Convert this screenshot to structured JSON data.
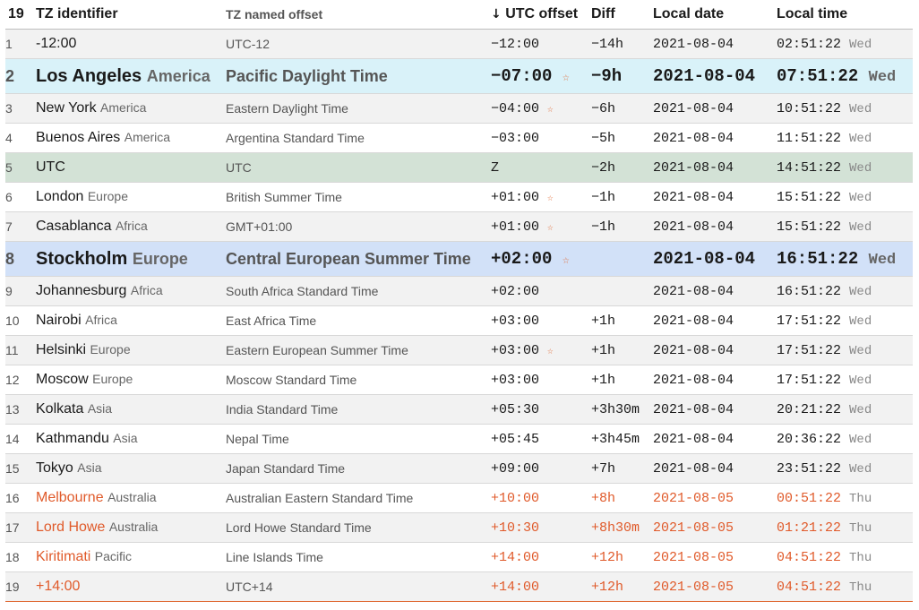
{
  "header": {
    "count": "19",
    "tz_identifier": "TZ identifier",
    "tz_named_offset": "TZ named offset",
    "sort_arrow": "↓",
    "utc_offset": "UTC offset",
    "diff": "Diff",
    "local_date": "Local date",
    "local_time": "Local time"
  },
  "rows": [
    {
      "idx": "1",
      "city": "-12:00",
      "region": "",
      "offset_name": "UTC-12",
      "utc": "−12:00",
      "star": "",
      "diff": "−14h",
      "date": "2021-08-04",
      "time": "02:51:22",
      "day": "Wed"
    },
    {
      "idx": "2",
      "city": "Los Angeles",
      "region": "America",
      "offset_name": "Pacific Daylight Time",
      "utc": "−07:00",
      "star": "☆",
      "diff": "−9h",
      "date": "2021-08-04",
      "time": "07:51:22",
      "day": "Wed"
    },
    {
      "idx": "3",
      "city": "New York",
      "region": "America",
      "offset_name": "Eastern Daylight Time",
      "utc": "−04:00",
      "star": "☆",
      "diff": "−6h",
      "date": "2021-08-04",
      "time": "10:51:22",
      "day": "Wed"
    },
    {
      "idx": "4",
      "city": "Buenos Aires",
      "region": "America",
      "offset_name": "Argentina Standard Time",
      "utc": "−03:00",
      "star": "",
      "diff": "−5h",
      "date": "2021-08-04",
      "time": "11:51:22",
      "day": "Wed"
    },
    {
      "idx": "5",
      "city": "UTC",
      "region": "",
      "offset_name": "UTC",
      "utc": "Z",
      "star": "",
      "diff": "−2h",
      "date": "2021-08-04",
      "time": "14:51:22",
      "day": "Wed"
    },
    {
      "idx": "6",
      "city": "London",
      "region": "Europe",
      "offset_name": "British Summer Time",
      "utc": "+01:00",
      "star": "☆",
      "diff": "−1h",
      "date": "2021-08-04",
      "time": "15:51:22",
      "day": "Wed"
    },
    {
      "idx": "7",
      "city": "Casablanca",
      "region": "Africa",
      "offset_name": "GMT+01:00",
      "utc": "+01:00",
      "star": "☆",
      "diff": "−1h",
      "date": "2021-08-04",
      "time": "15:51:22",
      "day": "Wed"
    },
    {
      "idx": "8",
      "city": "Stockholm",
      "region": "Europe",
      "offset_name": "Central European Summer Time",
      "utc": "+02:00",
      "star": "☆",
      "diff": "",
      "date": "2021-08-04",
      "time": "16:51:22",
      "day": "Wed"
    },
    {
      "idx": "9",
      "city": "Johannesburg",
      "region": "Africa",
      "offset_name": "South Africa Standard Time",
      "utc": "+02:00",
      "star": "",
      "diff": "",
      "date": "2021-08-04",
      "time": "16:51:22",
      "day": "Wed"
    },
    {
      "idx": "10",
      "city": "Nairobi",
      "region": "Africa",
      "offset_name": "East Africa Time",
      "utc": "+03:00",
      "star": "",
      "diff": "+1h",
      "date": "2021-08-04",
      "time": "17:51:22",
      "day": "Wed"
    },
    {
      "idx": "11",
      "city": "Helsinki",
      "region": "Europe",
      "offset_name": "Eastern European Summer Time",
      "utc": "+03:00",
      "star": "☆",
      "diff": "+1h",
      "date": "2021-08-04",
      "time": "17:51:22",
      "day": "Wed"
    },
    {
      "idx": "12",
      "city": "Moscow",
      "region": "Europe",
      "offset_name": "Moscow Standard Time",
      "utc": "+03:00",
      "star": "",
      "diff": "+1h",
      "date": "2021-08-04",
      "time": "17:51:22",
      "day": "Wed"
    },
    {
      "idx": "13",
      "city": "Kolkata",
      "region": "Asia",
      "offset_name": "India Standard Time",
      "utc": "+05:30",
      "star": "",
      "diff": "+3h30m",
      "date": "2021-08-04",
      "time": "20:21:22",
      "day": "Wed"
    },
    {
      "idx": "14",
      "city": "Kathmandu",
      "region": "Asia",
      "offset_name": "Nepal Time",
      "utc": "+05:45",
      "star": "",
      "diff": "+3h45m",
      "date": "2021-08-04",
      "time": "20:36:22",
      "day": "Wed"
    },
    {
      "idx": "15",
      "city": "Tokyo",
      "region": "Asia",
      "offset_name": "Japan Standard Time",
      "utc": "+09:00",
      "star": "",
      "diff": "+7h",
      "date": "2021-08-04",
      "time": "23:51:22",
      "day": "Wed"
    },
    {
      "idx": "16",
      "city": "Melbourne",
      "region": "Australia",
      "offset_name": "Australian Eastern Standard Time",
      "utc": "+10:00",
      "star": "",
      "diff": "+8h",
      "date": "2021-08-05",
      "time": "00:51:22",
      "day": "Thu"
    },
    {
      "idx": "17",
      "city": "Lord Howe",
      "region": "Australia",
      "offset_name": "Lord Howe Standard Time",
      "utc": "+10:30",
      "star": "",
      "diff": "+8h30m",
      "date": "2021-08-05",
      "time": "01:21:22",
      "day": "Thu"
    },
    {
      "idx": "18",
      "city": "Kiritimati",
      "region": "Pacific",
      "offset_name": "Line Islands Time",
      "utc": "+14:00",
      "star": "",
      "diff": "+12h",
      "date": "2021-08-05",
      "time": "04:51:22",
      "day": "Thu"
    },
    {
      "idx": "19",
      "city": "+14:00",
      "region": "",
      "offset_name": "UTC+14",
      "utc": "+14:00",
      "star": "",
      "diff": "+12h",
      "date": "2021-08-05",
      "time": "04:51:22",
      "day": "Thu"
    }
  ],
  "colors": {
    "future_date_text": "#e05a2a",
    "highlight_pacific": "#d9f2f9",
    "highlight_utc": "#d3e2d6",
    "highlight_local": "#d2e1f8",
    "star": "#e06a35"
  }
}
